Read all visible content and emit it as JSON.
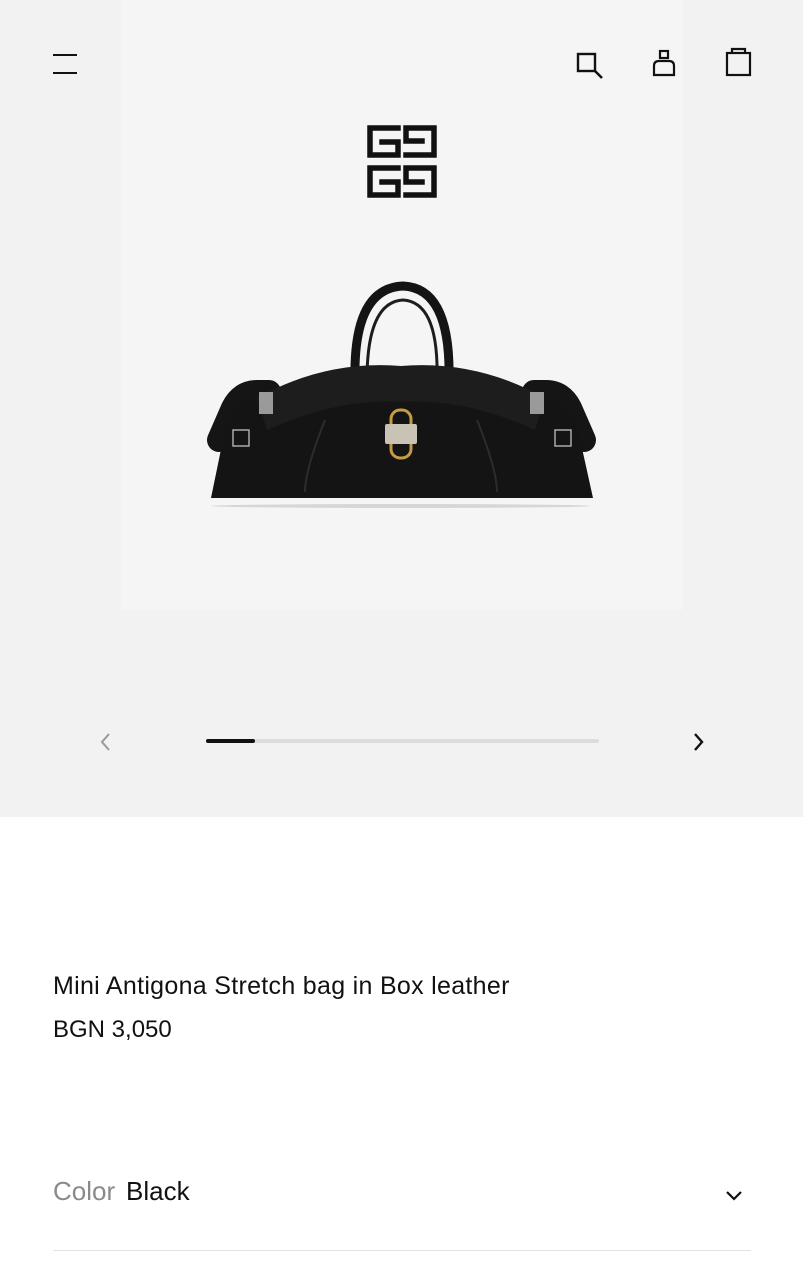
{
  "header": {
    "menu_icon": "menu-icon",
    "search_icon": "search-icon",
    "account_icon": "account-icon",
    "bag_icon": "shopping-bag-icon"
  },
  "gallery": {
    "current_index": 1,
    "progress_fraction": 0.125,
    "prev_icon": "chevron-left-icon",
    "next_icon": "chevron-right-icon",
    "accent": "#111111",
    "track_color": "#dcdcdc",
    "background": "#f3f2f2"
  },
  "product": {
    "name": "Mini Antigona Stretch bag in Box leather",
    "price": "BGN 3,050"
  },
  "color_selector": {
    "label": "Color",
    "value": "Black",
    "icon": "chevron-down-icon"
  }
}
